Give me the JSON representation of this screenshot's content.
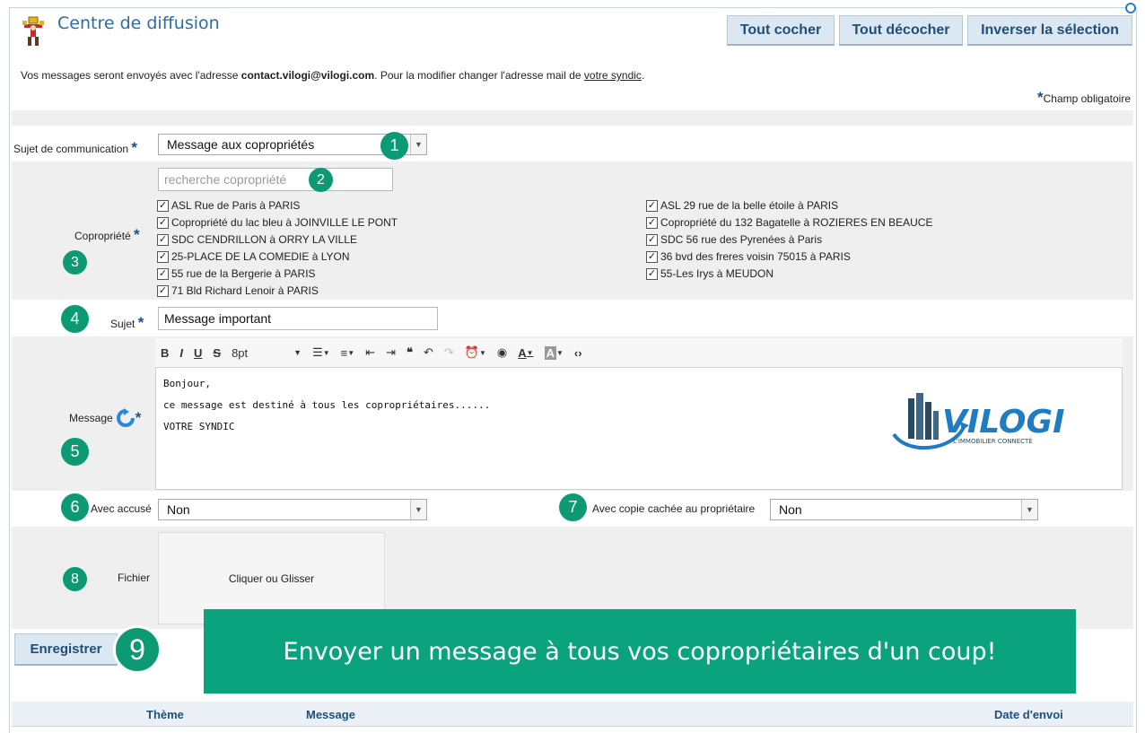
{
  "header": {
    "title": "Centre de diffusion",
    "buttons": [
      "Tout cocher",
      "Tout décocher",
      "Inverser la sélection"
    ]
  },
  "info": {
    "prefix": "Vos messages seront envoyés avec l'adresse ",
    "email": "contact.vilogi@vilogi.com",
    "middle": ". Pour la modifier changer l'adresse mail de ",
    "link": "votre syndic",
    "suffix": "."
  },
  "required_note": "Champ obligatoire",
  "required_mark": "*",
  "sujet_communication": {
    "label": "Sujet de communication",
    "value": "Message aux copropriétés",
    "badge": "1"
  },
  "copropriete": {
    "label": "Copropriété",
    "search_placeholder": "recherche copropriété",
    "search_badge": "2",
    "badge": "3",
    "left": [
      "ASL Rue de Paris à PARIS",
      "Copropriété du lac bleu à JOINVILLE LE PONT",
      "SDC CENDRILLON à ORRY LA VILLE",
      "25-PLACE DE LA COMEDIE à LYON",
      "55 rue de la Bergerie à PARIS",
      "71 Bld Richard Lenoir à PARIS"
    ],
    "right": [
      "ASL 29 rue de la belle étoile à PARIS",
      "Copropriété du 132 Bagatelle à ROZIERES EN BEAUCE",
      "SDC 56 rue des Pyrenées à Paris",
      "36 bvd des freres voisin 75015 à PARIS",
      "55-Les Irys à MEUDON"
    ]
  },
  "sujet": {
    "label": "Sujet",
    "value": "Message important",
    "badge": "4"
  },
  "message": {
    "label": "Message",
    "badge": "5",
    "font_size": "8pt",
    "lines": [
      "Bonjour,",
      "ce message est destiné à tous les copropriétaires......",
      "VOTRE SYNDIC"
    ],
    "logo_text": "VILOGI",
    "logo_tagline": "L'IMMOBILIER CONNECTÉ"
  },
  "avec_accuse": {
    "label": "Avec accusé",
    "value": "Non",
    "badge": "6"
  },
  "copie_cachee": {
    "label": "Avec copie cachée au propriétaire",
    "value": "Non",
    "badge": "7"
  },
  "fichier": {
    "label": "Fichier",
    "drop_text": "Cliquer ou Glisser",
    "badge": "8"
  },
  "save": {
    "label": "Enregistrer",
    "badge": "9"
  },
  "banner": "Envoyer un message à tous vos copropriétaires d'un coup!",
  "table": {
    "columns": [
      "Thème",
      "Message",
      "Date d'envoi"
    ]
  },
  "colors": {
    "accent_green": "#0aa37d",
    "badge_green": "#0b9a73",
    "title_blue": "#2b6ea6",
    "button_bg": "#dbe7f1"
  }
}
